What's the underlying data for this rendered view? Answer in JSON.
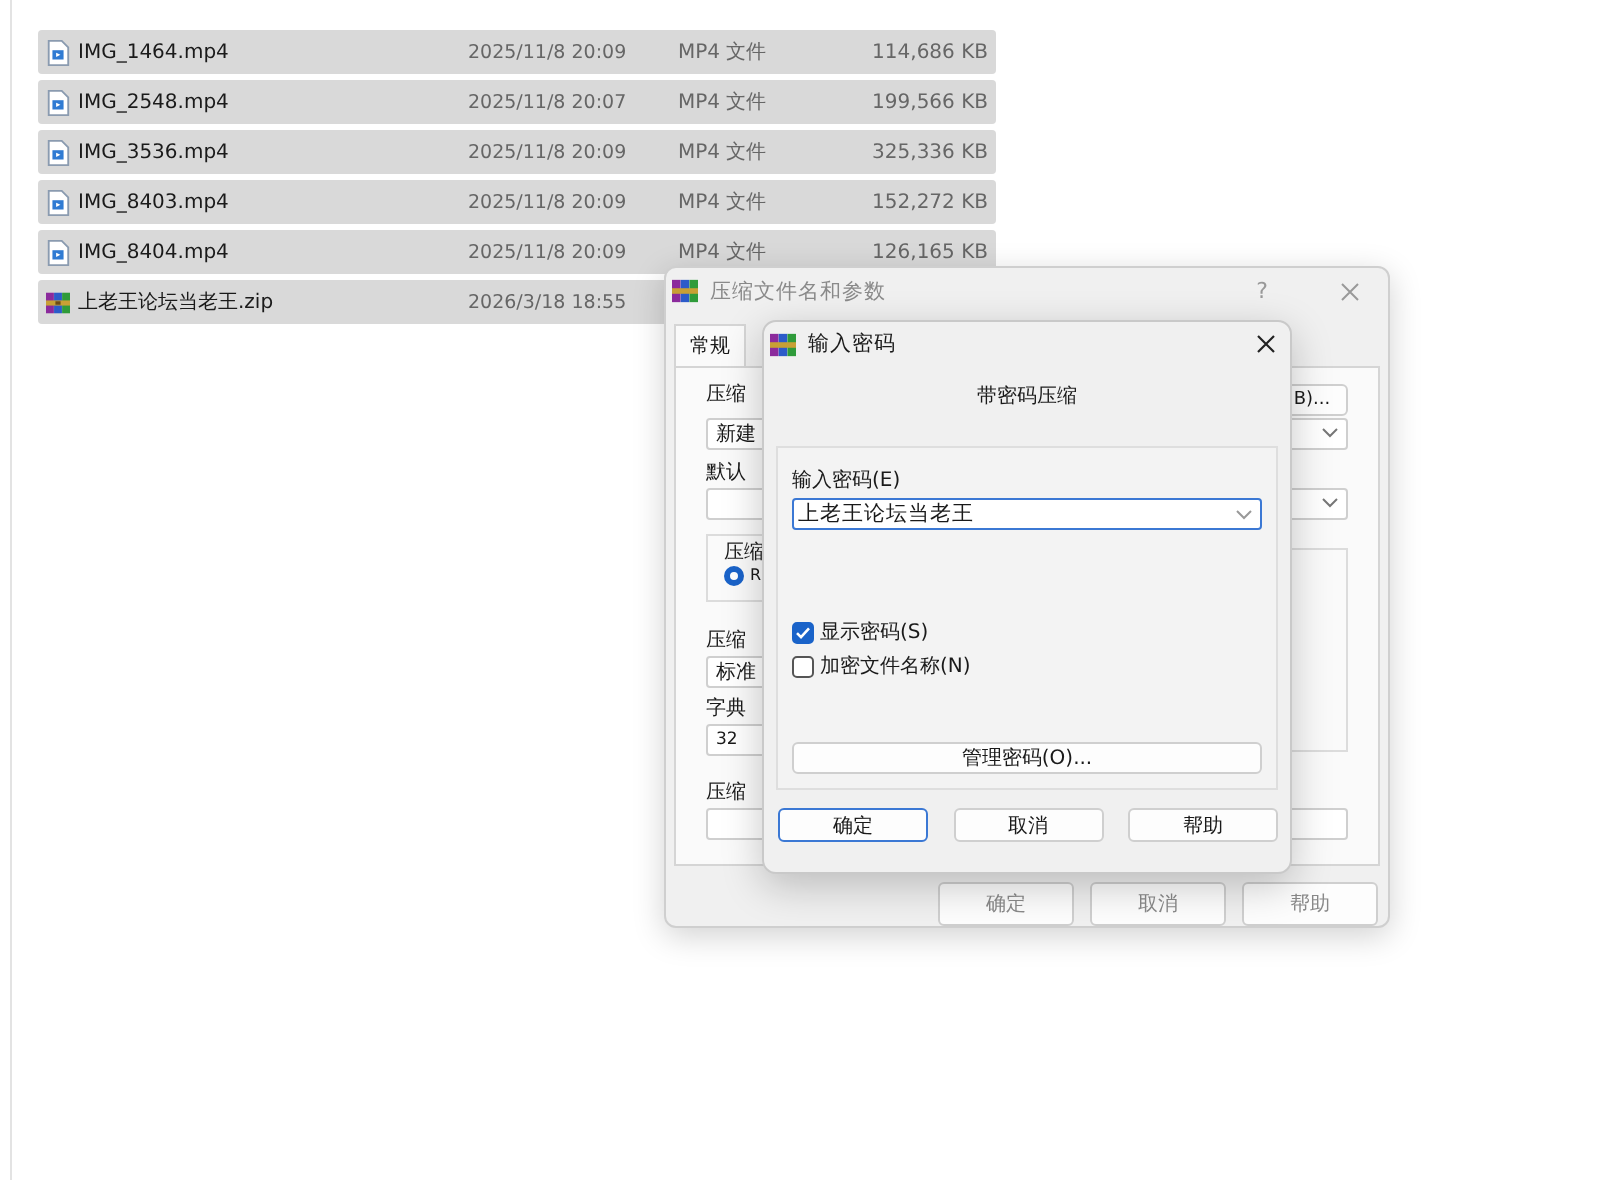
{
  "file_list": {
    "rows": [
      {
        "kind": "video",
        "name": "IMG_1464.mp4",
        "modified": "2025/11/8 20:09",
        "type": "MP4 文件",
        "size": "114,686 KB",
        "selected": true
      },
      {
        "kind": "video",
        "name": "IMG_2548.mp4",
        "modified": "2025/11/8 20:07",
        "type": "MP4 文件",
        "size": "199,566 KB",
        "selected": true
      },
      {
        "kind": "video",
        "name": "IMG_3536.mp4",
        "modified": "2025/11/8 20:09",
        "type": "MP4 文件",
        "size": "325,336 KB",
        "selected": true
      },
      {
        "kind": "video",
        "name": "IMG_8403.mp4",
        "modified": "2025/11/8 20:09",
        "type": "MP4 文件",
        "size": "152,272 KB",
        "selected": true
      },
      {
        "kind": "video",
        "name": "IMG_8404.mp4",
        "modified": "2025/11/8 20:09",
        "type": "MP4 文件",
        "size": "126,165 KB",
        "selected": true
      },
      {
        "kind": "archive",
        "name": "上老王论坛当老王.zip",
        "modified": "2026/3/18 18:55",
        "selected": true
      }
    ]
  },
  "archive_dialog": {
    "title": "压缩文件名和参数",
    "help": "?",
    "tabs": [
      {
        "label": "常规",
        "selected": true
      }
    ],
    "archive_name_label": "压缩",
    "browse_button": "B)...",
    "archive_name_value": "新建",
    "profile_label": "默认",
    "format_group_label": "压缩",
    "format_options": [
      {
        "label": "R",
        "selected": true
      }
    ],
    "method_label": "压缩",
    "method_value": "标准",
    "dictionary_label": "字典",
    "dictionary_value": "32",
    "split_label": "压缩",
    "buttons": [
      "确定",
      "取消",
      "帮助"
    ]
  },
  "password_dialog": {
    "title": "输入密码",
    "heading": "带密码压缩",
    "password_label": "输入密码(E)",
    "password_value": "上老王论坛当老王",
    "options": [
      {
        "label": "显示密码(S)",
        "checked": true
      },
      {
        "label": "加密文件名称(N)",
        "checked": false
      }
    ],
    "manage_button": "管理密码(O)...",
    "buttons": [
      {
        "label": "确定",
        "default": true
      },
      {
        "label": "取消",
        "default": false
      },
      {
        "label": "帮助",
        "default": false
      }
    ]
  }
}
